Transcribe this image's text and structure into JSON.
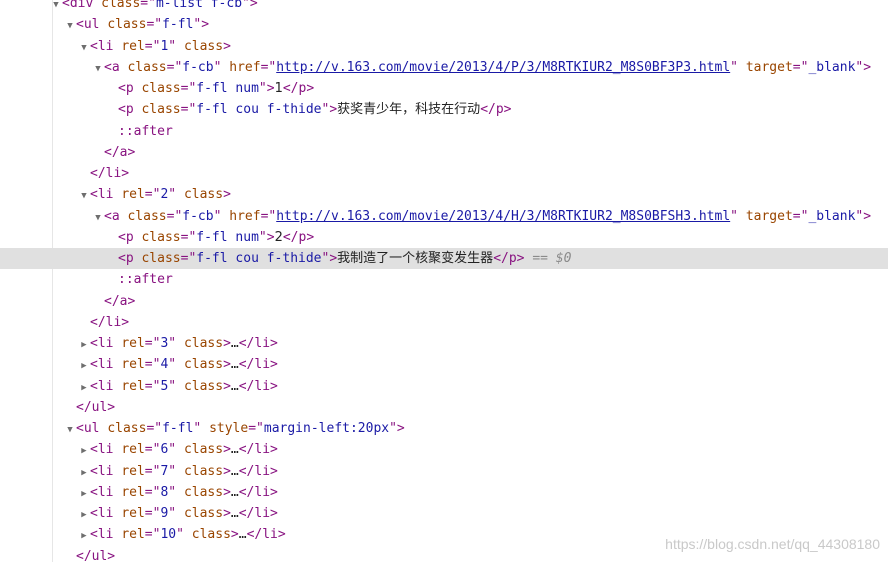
{
  "rows": [
    {
      "indent": 3,
      "toggle": "expanded",
      "tokens": [
        [
          "tag",
          "<div "
        ],
        [
          "attr",
          "class"
        ],
        [
          "tag",
          "=\""
        ],
        [
          "val",
          "m-list f-cb"
        ],
        [
          "tag",
          "\">"
        ]
      ]
    },
    {
      "indent": 4,
      "toggle": "expanded",
      "tokens": [
        [
          "tag",
          "<ul "
        ],
        [
          "attr",
          "class"
        ],
        [
          "tag",
          "=\""
        ],
        [
          "val",
          "f-fl"
        ],
        [
          "tag",
          "\">"
        ]
      ]
    },
    {
      "indent": 5,
      "toggle": "expanded",
      "tokens": [
        [
          "tag",
          "<li "
        ],
        [
          "attr",
          "rel"
        ],
        [
          "tag",
          "=\""
        ],
        [
          "val",
          "1"
        ],
        [
          "tag",
          "\" "
        ],
        [
          "attr",
          "class"
        ],
        [
          "tag",
          ">"
        ]
      ]
    },
    {
      "indent": 6,
      "toggle": "expanded",
      "tokens": [
        [
          "tag",
          "<a "
        ],
        [
          "attr",
          "class"
        ],
        [
          "tag",
          "=\""
        ],
        [
          "val",
          "f-cb"
        ],
        [
          "tag",
          "\" "
        ],
        [
          "attr",
          "href"
        ],
        [
          "tag",
          "=\""
        ],
        [
          "url",
          "http://v.163.com/movie/2013/4/P/3/M8RTKIUR2_M8S0BF3P3.html"
        ],
        [
          "tag",
          "\" "
        ],
        [
          "attr",
          "target"
        ],
        [
          "tag",
          "=\""
        ],
        [
          "val",
          "_blank"
        ],
        [
          "tag",
          "\">"
        ]
      ]
    },
    {
      "indent": 7,
      "toggle": "none",
      "tokens": [
        [
          "tag",
          "<p "
        ],
        [
          "attr",
          "class"
        ],
        [
          "tag",
          "=\""
        ],
        [
          "val",
          "f-fl num"
        ],
        [
          "tag",
          "\">"
        ],
        [
          "text",
          "1"
        ],
        [
          "tag",
          "</p>"
        ]
      ]
    },
    {
      "indent": 7,
      "toggle": "none",
      "tokens": [
        [
          "tag",
          "<p "
        ],
        [
          "attr",
          "class"
        ],
        [
          "tag",
          "=\""
        ],
        [
          "val",
          "f-fl cou f-thide"
        ],
        [
          "tag",
          "\">"
        ],
        [
          "text",
          "获奖青少年，科技在行动"
        ],
        [
          "tag",
          "</p>"
        ]
      ]
    },
    {
      "indent": 7,
      "toggle": "none",
      "tokens": [
        [
          "pseudo",
          "::after"
        ]
      ]
    },
    {
      "indent": 6,
      "toggle": "none",
      "tokens": [
        [
          "tag",
          "</a>"
        ]
      ]
    },
    {
      "indent": 5,
      "toggle": "none",
      "tokens": [
        [
          "tag",
          "</li>"
        ]
      ]
    },
    {
      "indent": 5,
      "toggle": "expanded",
      "tokens": [
        [
          "tag",
          "<li "
        ],
        [
          "attr",
          "rel"
        ],
        [
          "tag",
          "=\""
        ],
        [
          "val",
          "2"
        ],
        [
          "tag",
          "\" "
        ],
        [
          "attr",
          "class"
        ],
        [
          "tag",
          ">"
        ]
      ]
    },
    {
      "indent": 6,
      "toggle": "expanded",
      "tokens": [
        [
          "tag",
          "<a "
        ],
        [
          "attr",
          "class"
        ],
        [
          "tag",
          "=\""
        ],
        [
          "val",
          "f-cb"
        ],
        [
          "tag",
          "\" "
        ],
        [
          "attr",
          "href"
        ],
        [
          "tag",
          "=\""
        ],
        [
          "url",
          "http://v.163.com/movie/2013/4/H/3/M8RTKIUR2_M8S0BFSH3.html"
        ],
        [
          "tag",
          "\" "
        ],
        [
          "attr",
          "target"
        ],
        [
          "tag",
          "=\""
        ],
        [
          "val",
          "_blank"
        ],
        [
          "tag",
          "\">"
        ]
      ]
    },
    {
      "indent": 7,
      "toggle": "none",
      "tokens": [
        [
          "tag",
          "<p "
        ],
        [
          "attr",
          "class"
        ],
        [
          "tag",
          "=\""
        ],
        [
          "val",
          "f-fl num"
        ],
        [
          "tag",
          "\">"
        ],
        [
          "text",
          "2"
        ],
        [
          "tag",
          "</p>"
        ]
      ]
    },
    {
      "indent": 7,
      "toggle": "none",
      "selected": true,
      "tokens": [
        [
          "tag",
          "<p "
        ],
        [
          "attr",
          "class"
        ],
        [
          "tag",
          "=\""
        ],
        [
          "val",
          "f-fl cou f-thide"
        ],
        [
          "tag",
          "\">"
        ],
        [
          "text",
          "我制造了一个核聚变发生器"
        ],
        [
          "tag",
          "</p>"
        ],
        [
          "marker",
          " == $0"
        ]
      ]
    },
    {
      "indent": 7,
      "toggle": "none",
      "tokens": [
        [
          "pseudo",
          "::after"
        ]
      ]
    },
    {
      "indent": 6,
      "toggle": "none",
      "tokens": [
        [
          "tag",
          "</a>"
        ]
      ]
    },
    {
      "indent": 5,
      "toggle": "none",
      "tokens": [
        [
          "tag",
          "</li>"
        ]
      ]
    },
    {
      "indent": 5,
      "toggle": "collapsed",
      "tokens": [
        [
          "tag",
          "<li "
        ],
        [
          "attr",
          "rel"
        ],
        [
          "tag",
          "=\""
        ],
        [
          "val",
          "3"
        ],
        [
          "tag",
          "\" "
        ],
        [
          "attr",
          "class"
        ],
        [
          "tag",
          ">"
        ],
        [
          "ellip",
          "…"
        ],
        [
          "tag",
          "</li>"
        ]
      ]
    },
    {
      "indent": 5,
      "toggle": "collapsed",
      "tokens": [
        [
          "tag",
          "<li "
        ],
        [
          "attr",
          "rel"
        ],
        [
          "tag",
          "=\""
        ],
        [
          "val",
          "4"
        ],
        [
          "tag",
          "\" "
        ],
        [
          "attr",
          "class"
        ],
        [
          "tag",
          ">"
        ],
        [
          "ellip",
          "…"
        ],
        [
          "tag",
          "</li>"
        ]
      ]
    },
    {
      "indent": 5,
      "toggle": "collapsed",
      "tokens": [
        [
          "tag",
          "<li "
        ],
        [
          "attr",
          "rel"
        ],
        [
          "tag",
          "=\""
        ],
        [
          "val",
          "5"
        ],
        [
          "tag",
          "\" "
        ],
        [
          "attr",
          "class"
        ],
        [
          "tag",
          ">"
        ],
        [
          "ellip",
          "…"
        ],
        [
          "tag",
          "</li>"
        ]
      ]
    },
    {
      "indent": 4,
      "toggle": "none",
      "tokens": [
        [
          "tag",
          "</ul>"
        ]
      ]
    },
    {
      "indent": 4,
      "toggle": "expanded",
      "tokens": [
        [
          "tag",
          "<ul "
        ],
        [
          "attr",
          "class"
        ],
        [
          "tag",
          "=\""
        ],
        [
          "val",
          "f-fl"
        ],
        [
          "tag",
          "\" "
        ],
        [
          "attr",
          "style"
        ],
        [
          "tag",
          "=\""
        ],
        [
          "val",
          "margin-left:20px"
        ],
        [
          "tag",
          "\">"
        ]
      ]
    },
    {
      "indent": 5,
      "toggle": "collapsed",
      "tokens": [
        [
          "tag",
          "<li "
        ],
        [
          "attr",
          "rel"
        ],
        [
          "tag",
          "=\""
        ],
        [
          "val",
          "6"
        ],
        [
          "tag",
          "\" "
        ],
        [
          "attr",
          "class"
        ],
        [
          "tag",
          ">"
        ],
        [
          "ellip",
          "…"
        ],
        [
          "tag",
          "</li>"
        ]
      ]
    },
    {
      "indent": 5,
      "toggle": "collapsed",
      "tokens": [
        [
          "tag",
          "<li "
        ],
        [
          "attr",
          "rel"
        ],
        [
          "tag",
          "=\""
        ],
        [
          "val",
          "7"
        ],
        [
          "tag",
          "\" "
        ],
        [
          "attr",
          "class"
        ],
        [
          "tag",
          ">"
        ],
        [
          "ellip",
          "…"
        ],
        [
          "tag",
          "</li>"
        ]
      ]
    },
    {
      "indent": 5,
      "toggle": "collapsed",
      "tokens": [
        [
          "tag",
          "<li "
        ],
        [
          "attr",
          "rel"
        ],
        [
          "tag",
          "=\""
        ],
        [
          "val",
          "8"
        ],
        [
          "tag",
          "\" "
        ],
        [
          "attr",
          "class"
        ],
        [
          "tag",
          ">"
        ],
        [
          "ellip",
          "…"
        ],
        [
          "tag",
          "</li>"
        ]
      ]
    },
    {
      "indent": 5,
      "toggle": "collapsed",
      "tokens": [
        [
          "tag",
          "<li "
        ],
        [
          "attr",
          "rel"
        ],
        [
          "tag",
          "=\""
        ],
        [
          "val",
          "9"
        ],
        [
          "tag",
          "\" "
        ],
        [
          "attr",
          "class"
        ],
        [
          "tag",
          ">"
        ],
        [
          "ellip",
          "…"
        ],
        [
          "tag",
          "</li>"
        ]
      ]
    },
    {
      "indent": 5,
      "toggle": "collapsed",
      "tokens": [
        [
          "tag",
          "<li "
        ],
        [
          "attr",
          "rel"
        ],
        [
          "tag",
          "=\""
        ],
        [
          "val",
          "10"
        ],
        [
          "tag",
          "\" "
        ],
        [
          "attr",
          "class"
        ],
        [
          "tag",
          ">"
        ],
        [
          "ellip",
          "…"
        ],
        [
          "tag",
          "</li>"
        ]
      ]
    },
    {
      "indent": 4,
      "toggle": "none",
      "tokens": [
        [
          "tag",
          "</ul>"
        ]
      ]
    }
  ],
  "toggle_glyphs": {
    "expanded": "▼",
    "collapsed": "▶"
  },
  "colors": {
    "tag": "#881280",
    "attribute_name": "#994500",
    "attribute_value": "#1a1aa6",
    "selection_background": "#e0e0e0"
  },
  "watermark": "https://blog.csdn.net/qq_44308180"
}
